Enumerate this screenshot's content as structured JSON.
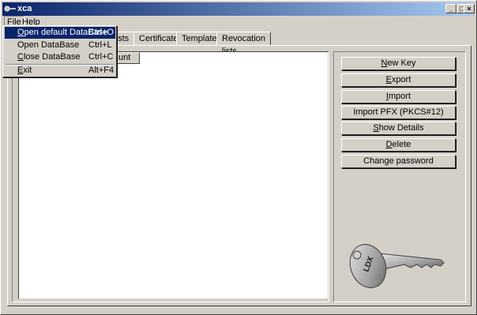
{
  "window": {
    "title": "xca"
  },
  "menubar": {
    "items": [
      {
        "label": "File",
        "accel": "F",
        "rest": "ile"
      },
      {
        "label": "Help",
        "accel": "H",
        "rest": "elp"
      }
    ]
  },
  "file_menu": {
    "items": [
      {
        "label": "Open default DataBase",
        "accel": "O",
        "rest": "pen default DataBase",
        "shortcut": "Ctrl+O",
        "highlighted": true
      },
      {
        "label": "Open DataBase",
        "accel": "",
        "rest": "Open DataBase",
        "shortcut": "Ctrl+L"
      },
      {
        "label": "Close DataBase",
        "accel": "C",
        "rest": "lose DataBase",
        "shortcut": "Ctrl+C"
      },
      {
        "label": "Exit",
        "accel": "E",
        "rest": "xit",
        "shortcut": "Alt+F4"
      }
    ]
  },
  "tabs": [
    "ests",
    "Certificates",
    "Templates",
    "Revocation lists"
  ],
  "list": {
    "column_partial": "unt"
  },
  "actions": {
    "new_key": {
      "accel": "N",
      "rest": "ew Key"
    },
    "export": {
      "accel": "E",
      "rest": "xport"
    },
    "import": {
      "accel": "I",
      "rest": "mport"
    },
    "import_pfx": {
      "label": "Import PFX (PKCS#12)"
    },
    "show_details": {
      "accel": "S",
      "rest": "how Details"
    },
    "delete": {
      "accel": "D",
      "rest": "elete"
    },
    "change_password": {
      "label": "Change password"
    }
  },
  "key_image": {
    "text": "LDX"
  },
  "colors": {
    "titlebar_start": "#0a246a",
    "titlebar_end": "#a6caf0",
    "highlight": "#0a246a",
    "face": "#d4d0c8"
  }
}
